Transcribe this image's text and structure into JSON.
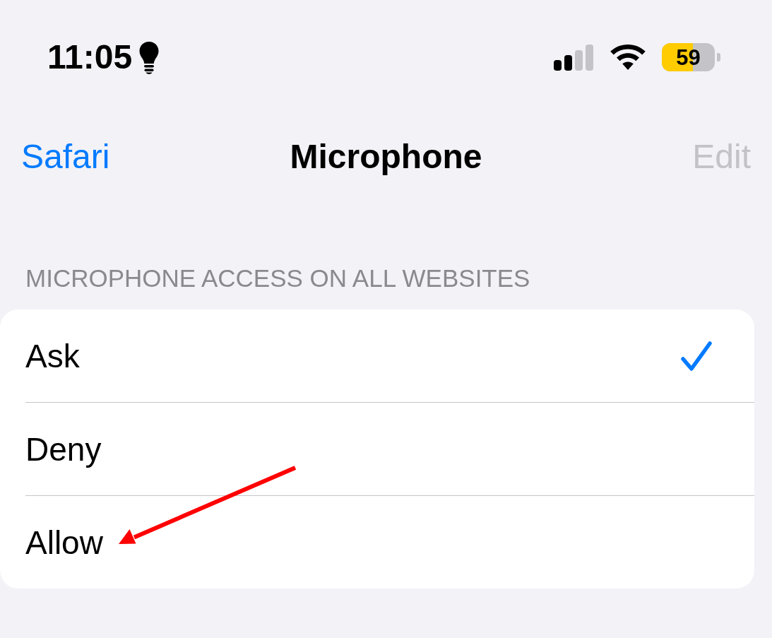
{
  "status_bar": {
    "time": "11:05",
    "battery": {
      "text": "59",
      "level": 0.59,
      "low_power": true
    }
  },
  "nav_bar": {
    "back": "Safari",
    "title": "Microphone",
    "edit": {
      "label": "Edit",
      "disabled": true
    }
  },
  "section": {
    "header": "MICROPHONE ACCESS ON ALL WEBSITES",
    "options": [
      {
        "label": "Ask",
        "selected": true
      },
      {
        "label": "Deny",
        "selected": false
      },
      {
        "label": "Allow",
        "selected": false
      }
    ]
  }
}
